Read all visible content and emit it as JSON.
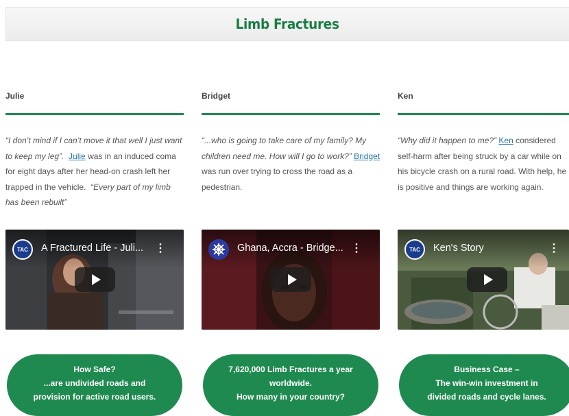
{
  "header": {
    "title": "Limb Fractures"
  },
  "columns": [
    {
      "name": "Julie",
      "story": {
        "quote1": "“I don’t mind if I can’t move it that well I just want to keep my leg”.",
        "link": "Julie",
        "text": " was in an induced coma for eight days after her head-on crash left her trapped in the vehicle.",
        "quote2": "“Every part of my limb has been rebuilt”"
      },
      "video": {
        "title": "A Fractured Life - Juli...",
        "channel_icon": "tac-logo-icon"
      },
      "pill": [
        "How Safe?",
        "...are undivided roads and",
        "provision for active road users."
      ]
    },
    {
      "name": "Bridget",
      "story": {
        "quote1": "“...who is going to take care of my family? My children need me. How will I go to work?”",
        "link": "Bridget",
        "text": " was run over trying to cross the road as a pedestrian.",
        "quote2": ""
      },
      "video": {
        "title": "Ghana, Accra - Bridge...",
        "channel_icon": "network-logo-icon"
      },
      "pill": [
        "7,620,000 Limb Fractures a year",
        "worldwide.",
        "How many in your country?"
      ]
    },
    {
      "name": "Ken",
      "story": {
        "quote1": "“Why did it happen to me?”",
        "link": "Ken",
        "text": " considered self-harm after being struck by a car while on his bicycle crash on a rural road.  With help, he is positive and things are working again.",
        "quote2": ""
      },
      "video": {
        "title": "Ken's Story",
        "channel_icon": "tac-logo-icon"
      },
      "pill": [
        "Business Case –",
        "The win-win investment in",
        "divided roads and cycle lanes."
      ]
    }
  ],
  "colors": {
    "accent": "#1e8a4f",
    "title": "#1a7d45",
    "link": "#2a78a8"
  }
}
